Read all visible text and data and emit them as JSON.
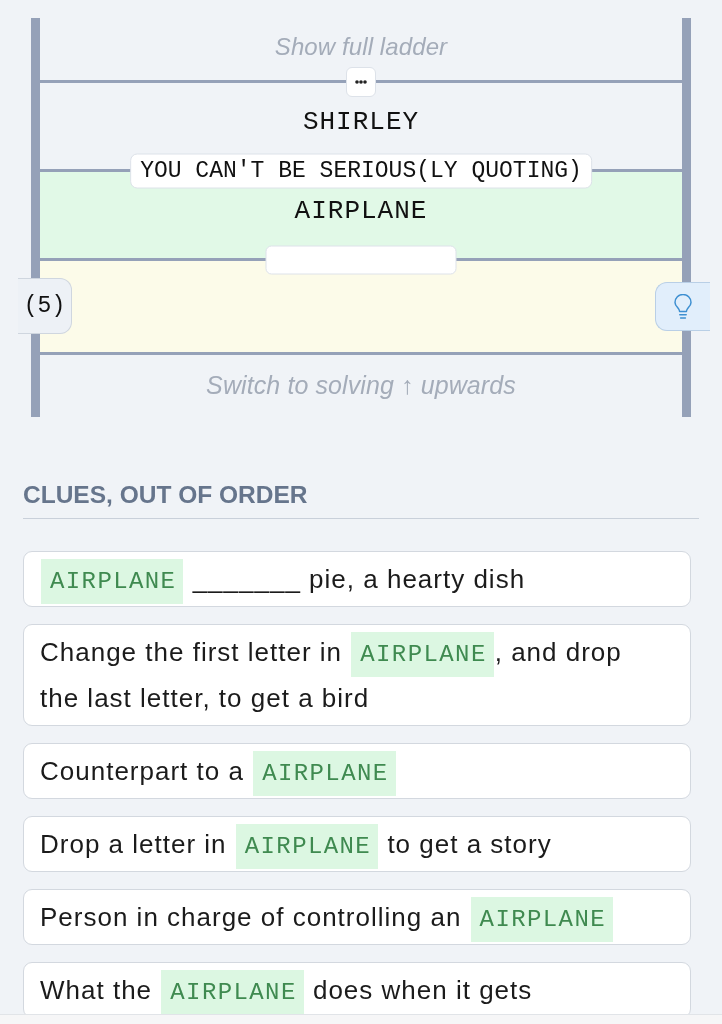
{
  "ladder": {
    "show_full_link": "Show full ladder",
    "items": [
      {
        "kind": "expand_rung"
      },
      {
        "kind": "word",
        "text": "SHIRLEY",
        "highlighted": false
      },
      {
        "kind": "clue_rung",
        "text": "YOU CAN'T BE SERIOUS(LY QUOTING)"
      },
      {
        "kind": "word",
        "text": "AIRPLANE",
        "highlighted": true
      },
      {
        "kind": "hidden_rung"
      },
      {
        "kind": "entry",
        "letter_count": "(5)",
        "active": true
      },
      {
        "kind": "rung"
      }
    ],
    "switch_link": "Switch to solving ↑ upwards"
  },
  "clues": {
    "heading": "CLUES, OUT OF ORDER",
    "items": [
      {
        "parts": [
          {
            "kind": "word",
            "text": "AIRPLANE"
          },
          {
            "kind": "text",
            "text": " _______ pie, a hearty dish"
          }
        ]
      },
      {
        "parts": [
          {
            "kind": "text",
            "text": "Change the first letter in "
          },
          {
            "kind": "word",
            "text": "AIRPLANE"
          },
          {
            "kind": "text",
            "text": ", and drop the last letter, to get a bird"
          }
        ]
      },
      {
        "parts": [
          {
            "kind": "text",
            "text": "Counterpart to a "
          },
          {
            "kind": "word",
            "text": "AIRPLANE"
          }
        ]
      },
      {
        "parts": [
          {
            "kind": "text",
            "text": "Drop a letter in "
          },
          {
            "kind": "word",
            "text": "AIRPLANE"
          },
          {
            "kind": "text",
            "text": " to get a story"
          }
        ]
      },
      {
        "parts": [
          {
            "kind": "text",
            "text": "Person in charge of controlling an "
          },
          {
            "kind": "word",
            "text": "AIRPLANE"
          }
        ]
      },
      {
        "parts": [
          {
            "kind": "text",
            "text": "What the "
          },
          {
            "kind": "word",
            "text": "AIRPLANE"
          },
          {
            "kind": "text",
            "text": " does when it gets"
          }
        ]
      }
    ]
  }
}
